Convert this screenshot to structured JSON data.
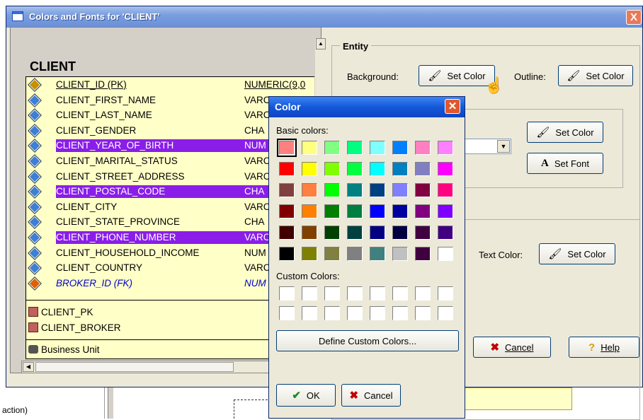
{
  "background": {
    "left_text": "action)"
  },
  "main_dialog": {
    "title": "Colors and Fonts for 'CLIENT'",
    "close_glyph": "X"
  },
  "entity": {
    "name": "CLIENT",
    "attributes": [
      {
        "name": "CLIENT_ID (PK)",
        "type": "NUMERIC(9,0",
        "kind": "pk",
        "highlight": false
      },
      {
        "name": "CLIENT_FIRST_NAME",
        "type": "VARC",
        "kind": "attr",
        "highlight": false
      },
      {
        "name": "CLIENT_LAST_NAME",
        "type": "VARC",
        "kind": "attr",
        "highlight": false
      },
      {
        "name": "CLIENT_GENDER",
        "type": "CHA",
        "kind": "attr",
        "highlight": false
      },
      {
        "name": "CLIENT_YEAR_OF_BIRTH",
        "type": "NUM",
        "kind": "attr",
        "highlight": true
      },
      {
        "name": "CLIENT_MARITAL_STATUS",
        "type": "VARC",
        "kind": "attr",
        "highlight": false
      },
      {
        "name": "CLIENT_STREET_ADDRESS",
        "type": "VARC",
        "kind": "attr",
        "highlight": false
      },
      {
        "name": "CLIENT_POSTAL_CODE",
        "type": "CHA",
        "kind": "attr",
        "highlight": true
      },
      {
        "name": "CLIENT_CITY",
        "type": "VARC",
        "kind": "attr",
        "highlight": false
      },
      {
        "name": "CLIENT_STATE_PROVINCE",
        "type": "CHA",
        "kind": "attr",
        "highlight": false
      },
      {
        "name": "CLIENT_PHONE_NUMBER",
        "type": "VARC",
        "kind": "attr",
        "highlight": true
      },
      {
        "name": "CLIENT_HOUSEHOLD_INCOME",
        "type": "NUM",
        "kind": "attr",
        "highlight": false
      },
      {
        "name": "CLIENT_COUNTRY",
        "type": "VARC",
        "kind": "attr",
        "highlight": false
      },
      {
        "name": "BROKER_ID (FK)",
        "type": "NUM",
        "kind": "fk",
        "highlight": false
      }
    ],
    "keys": [
      "CLIENT_PK",
      "CLIENT_BROKER"
    ],
    "subject_area": "Business Unit"
  },
  "entity_group": {
    "legend": "Entity",
    "background_label": "Background:",
    "outline_label": "Outline:",
    "set_color_label": "Set Color",
    "set_font_label": "Set Font",
    "text_color_label": "Text Color:",
    "cancel_label": "Cancel",
    "help_label": "Help"
  },
  "color_dialog": {
    "title": "Color",
    "basic_colors_label": "Basic colors:",
    "custom_colors_label": "Custom Colors:",
    "define_label": "Define Custom Colors...",
    "ok_label": "OK",
    "cancel_label": "Cancel",
    "basic_colors": [
      [
        "#ff8080",
        "#ffff80",
        "#80ff80",
        "#00ff80",
        "#80ffff",
        "#0080ff",
        "#ff80c0",
        "#ff80ff"
      ],
      [
        "#ff0000",
        "#ffff00",
        "#80ff00",
        "#00ff40",
        "#00ffff",
        "#0080c0",
        "#8080c0",
        "#ff00ff"
      ],
      [
        "#804040",
        "#ff8040",
        "#00ff00",
        "#008080",
        "#004080",
        "#8080ff",
        "#800040",
        "#ff0080"
      ],
      [
        "#800000",
        "#ff8000",
        "#008000",
        "#008040",
        "#0000ff",
        "#0000a0",
        "#800080",
        "#8000ff"
      ],
      [
        "#400000",
        "#804000",
        "#004000",
        "#004040",
        "#000080",
        "#000040",
        "#400040",
        "#400080"
      ],
      [
        "#000000",
        "#808000",
        "#808040",
        "#808080",
        "#408080",
        "#c0c0c0",
        "#400040",
        "#ffffff"
      ]
    ],
    "selected_index": [
      0,
      0
    ]
  },
  "colors": {
    "highlight": "#8a1ee8",
    "entity_fill": "#ffffc8",
    "title_bar": "#0e45c6"
  }
}
